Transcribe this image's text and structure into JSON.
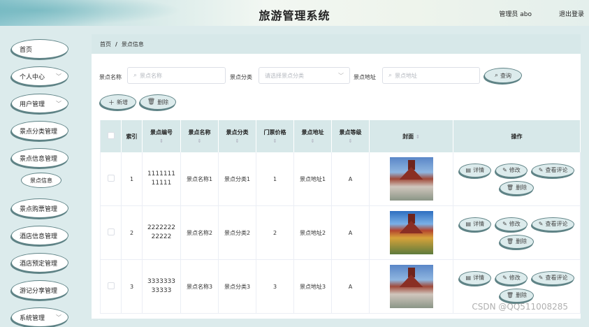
{
  "header": {
    "title": "旅游管理系统",
    "user": "管理员 abo",
    "logout": "退出登录"
  },
  "sidebar": {
    "items": [
      {
        "label": "首页",
        "has_sub": false
      },
      {
        "label": "个人中心",
        "has_sub": true
      },
      {
        "label": "用户管理",
        "has_sub": true
      },
      {
        "label": "景点分类管理",
        "has_sub": false
      },
      {
        "label": "景点信息管理",
        "has_sub": false
      },
      {
        "label": "景点信息",
        "sub": true
      },
      {
        "label": "景点购票管理",
        "has_sub": false
      },
      {
        "label": "酒店信息管理",
        "has_sub": false
      },
      {
        "label": "酒店预定管理",
        "has_sub": false
      },
      {
        "label": "游记分享管理",
        "has_sub": false
      },
      {
        "label": "系统管理",
        "has_sub": true
      }
    ]
  },
  "breadcrumb": {
    "home": "首页",
    "separator": "/",
    "current": "景点信息"
  },
  "search": {
    "name_label": "景点名称",
    "name_placeholder": "景点名称",
    "category_label": "景点分类",
    "category_placeholder": "请选择景点分类",
    "address_label": "景点地址",
    "address_placeholder": "景点地址",
    "query_button": "查询"
  },
  "actions": {
    "add": "新增",
    "delete": "删除"
  },
  "table": {
    "headers": [
      "索引",
      "景点编号",
      "景点名称",
      "景点分类",
      "门票价格",
      "景点地址",
      "景点等级",
      "封面",
      "操作"
    ],
    "rows": [
      {
        "index": "1",
        "code": "111111111111",
        "name": "景点名称1",
        "category": "景点分类1",
        "price": "1",
        "address": "景点地址1",
        "level": "A"
      },
      {
        "index": "2",
        "code": "222222222222",
        "name": "景点名称2",
        "category": "景点分类2",
        "price": "2",
        "address": "景点地址2",
        "level": "A"
      },
      {
        "index": "3",
        "code": "333333333333",
        "name": "景点名称3",
        "category": "景点分类3",
        "price": "3",
        "address": "景点地址3",
        "level": "A"
      }
    ],
    "ops": {
      "detail": "详情",
      "edit": "修改",
      "comments": "查看评论",
      "delete": "删除"
    }
  },
  "watermark": "CSDN @QQ511008285"
}
